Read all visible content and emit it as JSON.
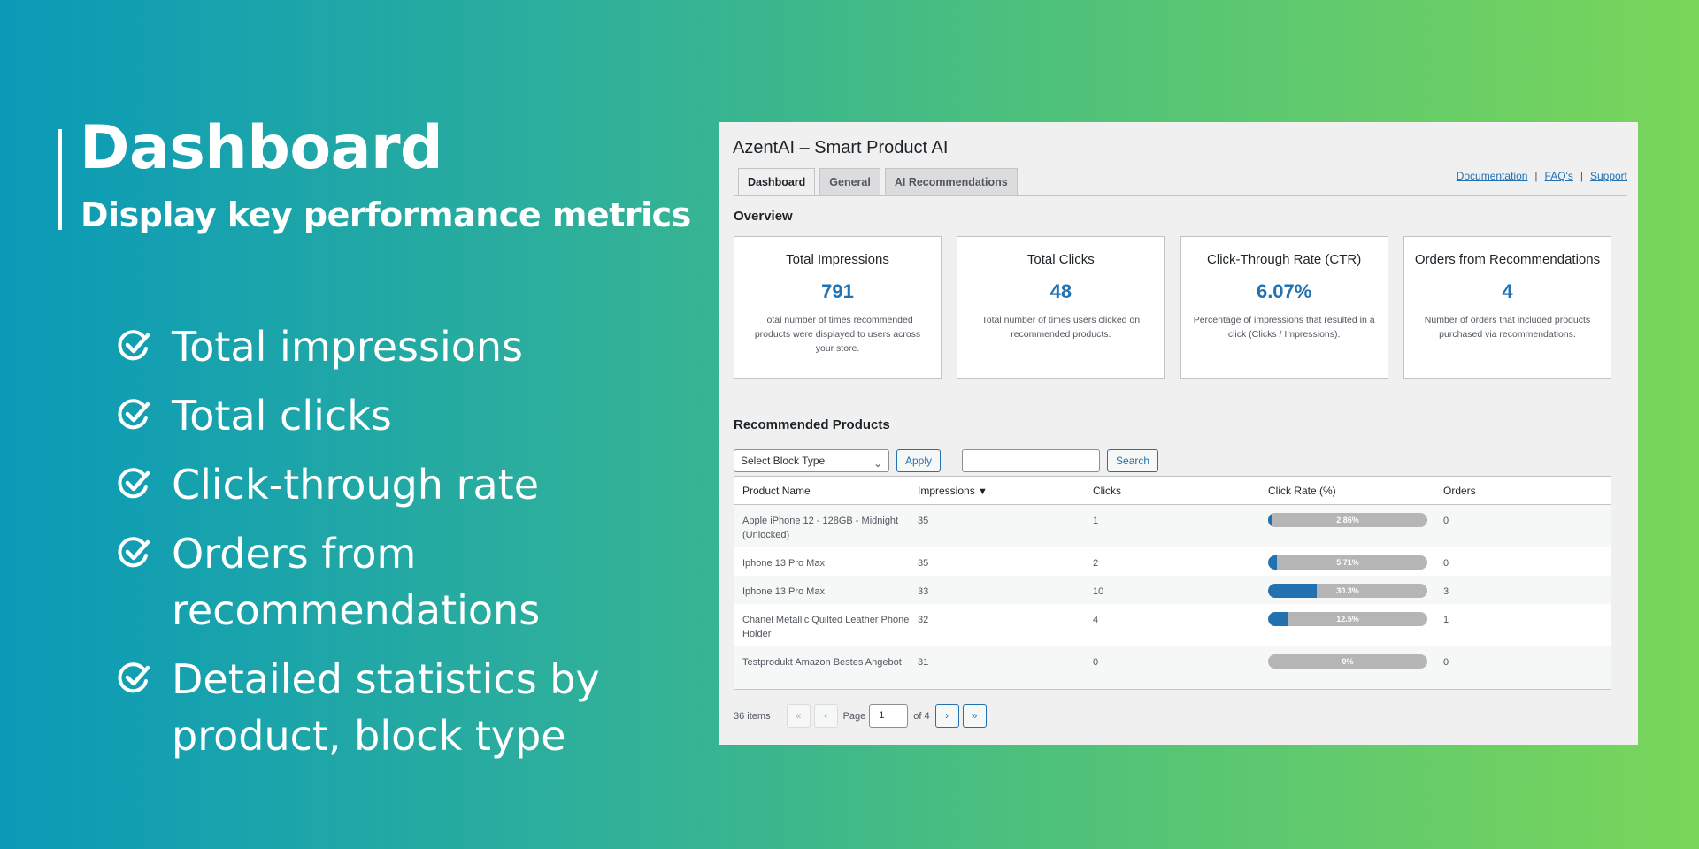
{
  "promo": {
    "title": "Dashboard",
    "subtitle": "Display key performance metrics",
    "features": [
      {
        "line1": "Total impressions",
        "line2": ""
      },
      {
        "line1": "Total clicks",
        "line2": ""
      },
      {
        "line1": "Click-through rate",
        "line2": ""
      },
      {
        "line1": "Orders from",
        "line2": "recommendations"
      },
      {
        "line1": "Detailed statistics by",
        "line2": "product, block type"
      }
    ]
  },
  "app": {
    "title": "AzentAI – Smart Product AI",
    "tabs": [
      "Dashboard",
      "General",
      "AI Recommendations"
    ],
    "links": [
      "Documentation",
      "FAQ's",
      "Support"
    ],
    "link_separator": "|",
    "overview_heading": "Overview",
    "cards": [
      {
        "title": "Total Impressions",
        "value": "791",
        "desc": "Total number of times recommended products were displayed to users across your store."
      },
      {
        "title": "Total Clicks",
        "value": "48",
        "desc": "Total number of times users clicked on recommended products."
      },
      {
        "title": "Click-Through Rate (CTR)",
        "value": "6.07%",
        "desc": "Percentage of impressions that resulted in a click (Clicks / Impressions)."
      },
      {
        "title": "Orders from Recommendations",
        "value": "4",
        "desc": "Number of orders that included products purchased via recommendations."
      }
    ],
    "products_heading": "Recommended Products",
    "filter": {
      "select_value": "Select Block Type",
      "apply_label": "Apply",
      "search_value": "",
      "search_label": "Search"
    },
    "table": {
      "columns": [
        "Product Name",
        "Impressions",
        "Clicks",
        "Click Rate (%)",
        "Orders"
      ],
      "sort_indicator": "▼",
      "rows": [
        {
          "name": "Apple iPhone 12 - 128GB - Midnight (Unlocked)",
          "impressions": "35",
          "clicks": "1",
          "rate_label": "2.86%",
          "rate": 2.86,
          "orders": "0"
        },
        {
          "name": "Iphone 13 Pro Max",
          "impressions": "35",
          "clicks": "2",
          "rate_label": "5.71%",
          "rate": 5.71,
          "orders": "0"
        },
        {
          "name": "Iphone 13 Pro Max",
          "impressions": "33",
          "clicks": "10",
          "rate_label": "30.3%",
          "rate": 30.3,
          "orders": "3"
        },
        {
          "name": "Chanel Metallic Quilted Leather Phone Holder",
          "impressions": "32",
          "clicks": "4",
          "rate_label": "12.5%",
          "rate": 12.5,
          "orders": "1"
        },
        {
          "name": "Testprodukt Amazon Bestes Angebot",
          "impressions": "31",
          "clicks": "0",
          "rate_label": "0%",
          "rate": 0,
          "orders": "0"
        }
      ]
    },
    "pagination": {
      "items_text": "36 items",
      "first": "«",
      "prev": "‹",
      "page_label": "Page",
      "current_page": "1",
      "of_text": "of 4",
      "next": "›",
      "last": "»"
    },
    "colors": {
      "accent": "#2271b1",
      "bar_track": "#b5b5b5"
    }
  }
}
